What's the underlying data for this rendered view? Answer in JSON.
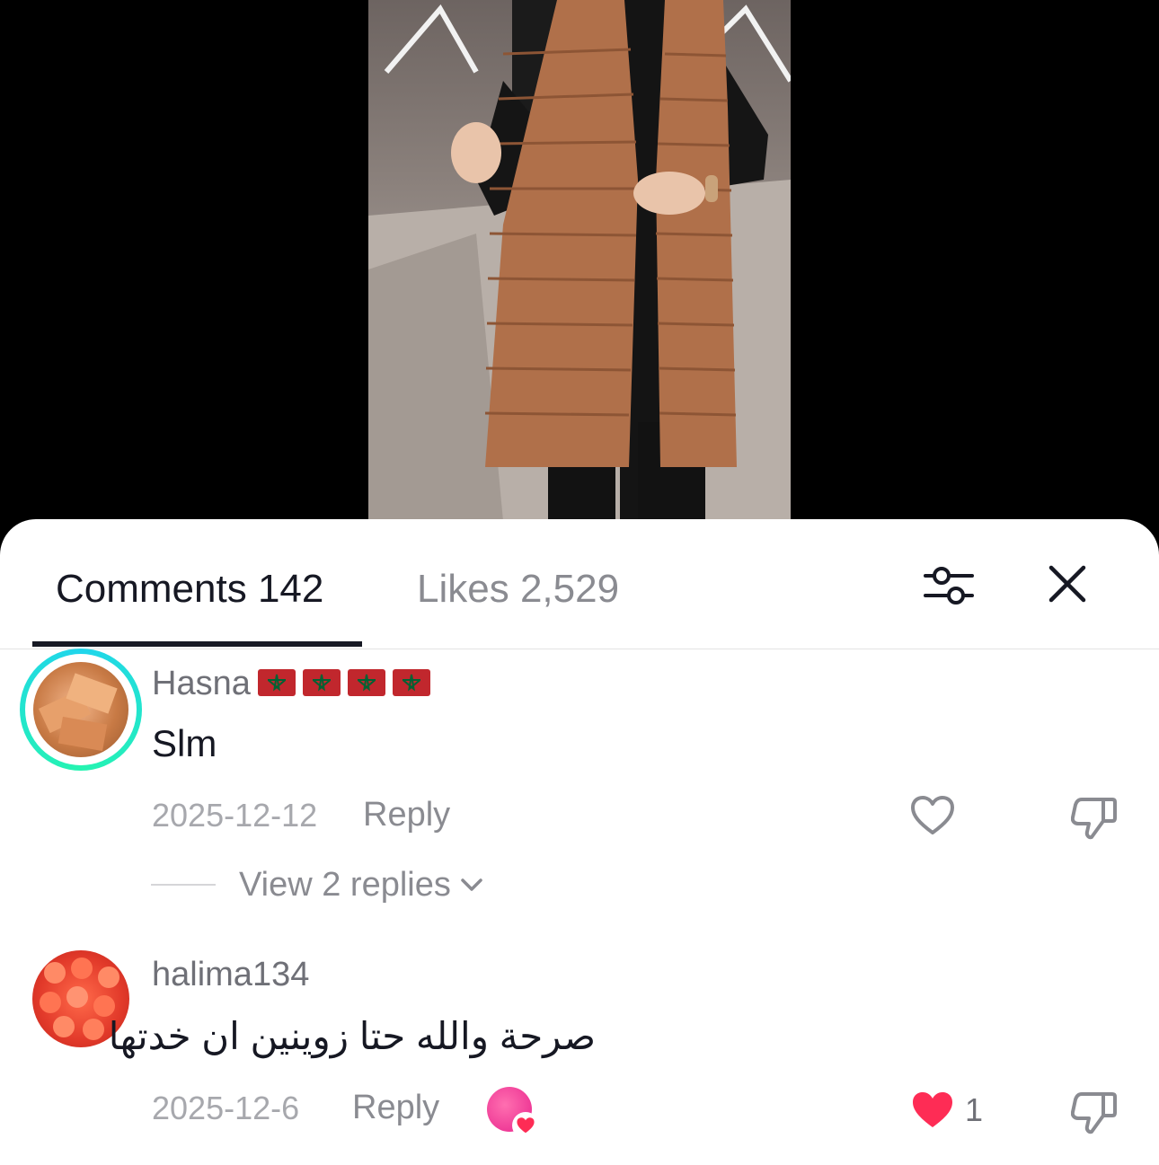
{
  "tabs": {
    "comments_label": "Comments 142",
    "likes_label": "Likes 2,529"
  },
  "icons": {
    "filter": "sliders-icon",
    "close": "close-icon"
  },
  "comments": [
    {
      "username": "Hasna",
      "username_flags": [
        "morocco-flag",
        "morocco-flag",
        "morocco-flag",
        "morocco-flag"
      ],
      "text": "Slm",
      "date": "2025-12-12",
      "reply_label": "Reply",
      "view_replies_label": "View 2 replies",
      "liked": false
    },
    {
      "username": "halima134",
      "text": "صرحة والله حتا زوينين ان خدتها",
      "date": "2025-12-6",
      "reply_label": "Reply",
      "like_count": "1",
      "liked": true,
      "liked_by_creator": true
    }
  ],
  "colors": {
    "primary_text": "#161823",
    "secondary_text": "#8a8b91",
    "liked_heart": "#fe2c55",
    "story_ring": "#20d5ec",
    "creator_badge": "#e8248c"
  }
}
